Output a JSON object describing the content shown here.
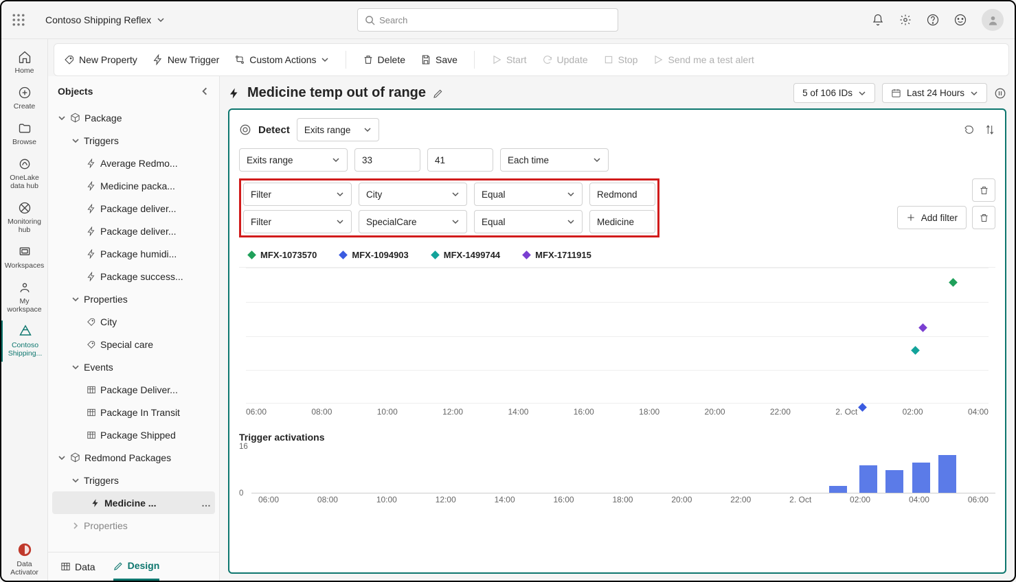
{
  "app_name": "Contoso Shipping Reflex",
  "search_placeholder": "Search",
  "toolbar": {
    "new_property": "New Property",
    "new_trigger": "New Trigger",
    "custom_actions": "Custom Actions",
    "delete": "Delete",
    "save": "Save",
    "start": "Start",
    "update": "Update",
    "stop": "Stop",
    "send_test": "Send me a test alert"
  },
  "left_rail": [
    {
      "label": "Home"
    },
    {
      "label": "Create"
    },
    {
      "label": "Browse"
    },
    {
      "label": "OneLake data hub"
    },
    {
      "label": "Monitoring hub"
    },
    {
      "label": "Workspaces"
    },
    {
      "label": "My workspace"
    },
    {
      "label": "Contoso Shipping..."
    }
  ],
  "data_activator": "Data Activator",
  "objects_panel": {
    "title": "Objects",
    "package": "Package",
    "triggers": "Triggers",
    "triggers_list": [
      "Average Redmo...",
      "Medicine packa...",
      "Package deliver...",
      "Package deliver...",
      "Package humidi...",
      "Package success..."
    ],
    "properties": "Properties",
    "prop_list": [
      "City",
      "Special care"
    ],
    "events": "Events",
    "events_list": [
      "Package Deliver...",
      "Package In Transit",
      "Package Shipped"
    ],
    "redmond": "Redmond Packages",
    "triggers2": "Triggers",
    "selected_trigger": "Medicine ...",
    "properties2": "Properties"
  },
  "bottom_tabs": [
    "Data",
    "Design"
  ],
  "canvas": {
    "title": "Medicine temp out of range",
    "ids_label": "5 of 106 IDs",
    "time_label": "Last 24 Hours",
    "detect_label": "Detect",
    "detect_mode": "Exits range",
    "row1": [
      "Exits range",
      "33",
      "41",
      "Each time"
    ],
    "filter_rows": [
      {
        "a": "Filter",
        "b": "City",
        "c": "Equal",
        "d": "Redmond"
      },
      {
        "a": "Filter",
        "b": "SpecialCare",
        "c": "Equal",
        "d": "Medicine"
      }
    ],
    "add_filter": "Add filter"
  },
  "chart_data": {
    "type": "scatter",
    "series": [
      {
        "name": "MFX-1073570",
        "color": "#1fa05a",
        "points": [
          {
            "x": "04:40",
            "y": 44
          }
        ]
      },
      {
        "name": "MFX-1094903",
        "color": "#3a5be0",
        "points": [
          {
            "x": "02:00",
            "y": 33
          }
        ]
      },
      {
        "name": "MFX-1499744",
        "color": "#12a39a",
        "points": [
          {
            "x": "03:40",
            "y": 38
          }
        ]
      },
      {
        "name": "MFX-1711915",
        "color": "#7a3fd1",
        "points": [
          {
            "x": "03:50",
            "y": 40
          }
        ]
      }
    ],
    "x_ticks": [
      "06:00",
      "08:00",
      "10:00",
      "12:00",
      "14:00",
      "16:00",
      "18:00",
      "20:00",
      "22:00",
      "2. Oct",
      "02:00",
      "04:00"
    ],
    "ylim": [
      33,
      45
    ]
  },
  "trigger_activations": {
    "title": "Trigger activations",
    "type": "bar",
    "x_ticks": [
      "06:00",
      "08:00",
      "10:00",
      "12:00",
      "14:00",
      "16:00",
      "18:00",
      "20:00",
      "22:00",
      "2. Oct",
      "02:00",
      "04:00",
      "06:00"
    ],
    "y_ticks": [
      0,
      16
    ],
    "values": [
      0,
      0,
      0,
      0,
      0,
      0,
      0,
      0,
      0,
      0,
      3,
      11,
      9,
      12,
      15
    ]
  }
}
